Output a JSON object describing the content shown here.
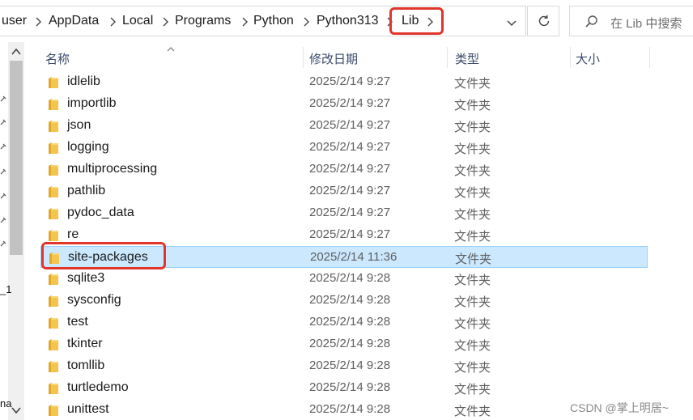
{
  "breadcrumb": {
    "items": [
      "user",
      "AppData",
      "Local",
      "Programs",
      "Python",
      "Python313",
      "Lib"
    ]
  },
  "search": {
    "placeholder": "在 Lib 中搜索"
  },
  "columns": {
    "name": "名称",
    "modified": "修改日期",
    "type": "类型",
    "size": "大小"
  },
  "files": [
    {
      "name": "idlelib",
      "modified": "2025/2/14 9:27",
      "type": "文件夹"
    },
    {
      "name": "importlib",
      "modified": "2025/2/14 9:27",
      "type": "文件夹"
    },
    {
      "name": "json",
      "modified": "2025/2/14 9:27",
      "type": "文件夹"
    },
    {
      "name": "logging",
      "modified": "2025/2/14 9:27",
      "type": "文件夹"
    },
    {
      "name": "multiprocessing",
      "modified": "2025/2/14 9:27",
      "type": "文件夹"
    },
    {
      "name": "pathlib",
      "modified": "2025/2/14 9:27",
      "type": "文件夹"
    },
    {
      "name": "pydoc_data",
      "modified": "2025/2/14 9:27",
      "type": "文件夹"
    },
    {
      "name": "re",
      "modified": "2025/2/14 9:27",
      "type": "文件夹"
    },
    {
      "name": "site-packages",
      "modified": "2025/2/14 11:36",
      "type": "文件夹",
      "selected": true
    },
    {
      "name": "sqlite3",
      "modified": "2025/2/14 9:28",
      "type": "文件夹"
    },
    {
      "name": "sysconfig",
      "modified": "2025/2/14 9:28",
      "type": "文件夹"
    },
    {
      "name": "test",
      "modified": "2025/2/14 9:28",
      "type": "文件夹"
    },
    {
      "name": "tkinter",
      "modified": "2025/2/14 9:28",
      "type": "文件夹"
    },
    {
      "name": "tomllib",
      "modified": "2025/2/14 9:28",
      "type": "文件夹"
    },
    {
      "name": "turtledemo",
      "modified": "2025/2/14 9:28",
      "type": "文件夹"
    },
    {
      "name": "unittest",
      "modified": "2025/2/14 9:28",
      "type": "文件夹"
    }
  ],
  "nav_stubs": [
    "_1",
    "na"
  ],
  "watermark": "CSDN @掌上明居~",
  "colors": {
    "highlight": "#e0362c",
    "selection_bg": "#cce8ff",
    "selection_border": "#99d1ff",
    "folder": "#f4c44b"
  },
  "icons": {
    "folder": "folder-icon",
    "chevron": "chevron-right-icon",
    "dropdown": "chevron-down-icon",
    "refresh": "refresh-icon",
    "search": "search-icon",
    "sort": "sort-up-icon",
    "pin": "pin-icon"
  }
}
